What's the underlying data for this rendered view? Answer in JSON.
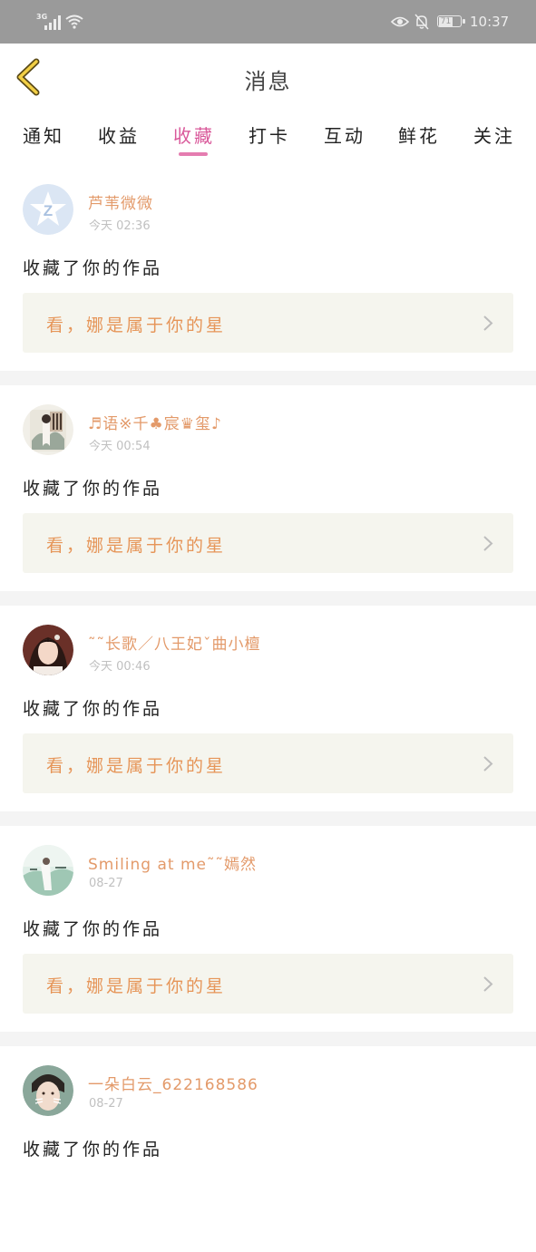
{
  "status_bar": {
    "network": "3G",
    "battery": "71",
    "time": "10:37"
  },
  "header": {
    "title": "消息"
  },
  "tabs": [
    {
      "label": "通知",
      "active": false
    },
    {
      "label": "收益",
      "active": false
    },
    {
      "label": "收藏",
      "active": true
    },
    {
      "label": "打卡",
      "active": false
    },
    {
      "label": "互动",
      "active": false
    },
    {
      "label": "鲜花",
      "active": false
    },
    {
      "label": "关注",
      "active": false
    }
  ],
  "colors": {
    "accent_tab": "#d9589a",
    "username": "#e39a6a",
    "card_title": "#e69558",
    "card_bg": "#f5f5ee"
  },
  "messages": [
    {
      "username": "芦苇微微",
      "time": "今天 02:36",
      "action": "收藏了你的作品",
      "work_title": "看，娜是属于你的星",
      "avatar": "default-avatar"
    },
    {
      "username": "♬语※千♣宸♛玺♪",
      "time": "今天 00:54",
      "action": "收藏了你的作品",
      "work_title": "看，娜是属于你的星",
      "avatar": "poster-avatar"
    },
    {
      "username": "˜˜长歌／八王妃ˇ曲小檀",
      "time": "今天 00:46",
      "action": "收藏了你的作品",
      "work_title": "看，娜是属于你的星",
      "avatar": "portrait-avatar"
    },
    {
      "username": "Smiling at me˜˜嫣然",
      "time": "08-27",
      "action": "收藏了你的作品",
      "work_title": "看，娜是属于你的星",
      "avatar": "scenery-avatar"
    },
    {
      "username": "一朵白云_622168586",
      "time": "08-27",
      "action": "收藏了你的作品",
      "work_title": "",
      "avatar": "face-avatar"
    }
  ]
}
